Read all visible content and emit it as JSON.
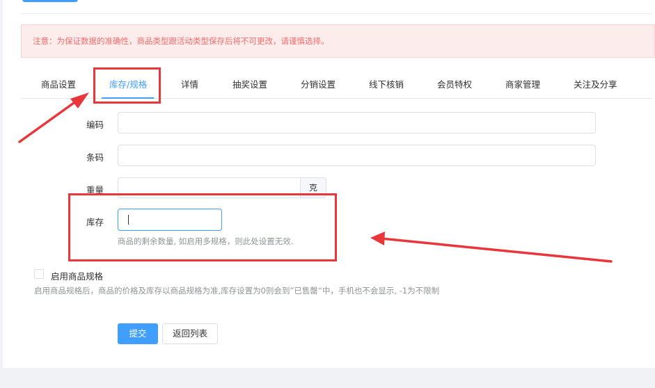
{
  "notice": {
    "text": "注意：为保证数据的准确性，商品类型跟活动类型保存后将不可更改，请谨慎选择。"
  },
  "tabs": [
    {
      "label": "商品设置"
    },
    {
      "label": "库存/规格",
      "active": true
    },
    {
      "label": "详情"
    },
    {
      "label": "抽奖设置"
    },
    {
      "label": "分销设置"
    },
    {
      "label": "线下核销"
    },
    {
      "label": "会员特权"
    },
    {
      "label": "商家管理"
    },
    {
      "label": "关注及分享"
    }
  ],
  "form": {
    "code": {
      "label": "编码",
      "value": ""
    },
    "barcode": {
      "label": "条码",
      "value": ""
    },
    "weight": {
      "label": "重量",
      "value": "",
      "unit": "克"
    },
    "stock": {
      "label": "库存",
      "value": "",
      "hint": "商品的剩余数量, 如启用多规格，则此处设置无效."
    }
  },
  "spec": {
    "label": "启用商品规格",
    "checked": false,
    "hint": "启用商品规格后，商品的价格及库存以商品规格为准,库存设置为0则会到”已售罄“中，手机也不会显示, -1为不限制"
  },
  "actions": {
    "submit": "提交",
    "back": "返回列表"
  },
  "colors": {
    "accent": "#409eff",
    "annotation": "#e8363a",
    "notice_text": "#f56c6c"
  }
}
